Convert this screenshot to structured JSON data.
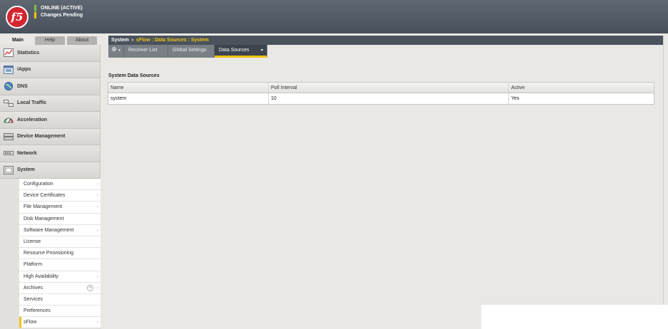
{
  "header": {
    "logo_text": "f5",
    "status_online": "ONLINE (ACTIVE)",
    "status_pending": "Changes Pending",
    "status_colors": {
      "online": "#7dc242",
      "pending": "#f1c40f"
    }
  },
  "top_tabs": [
    {
      "label": "Main",
      "active": true
    },
    {
      "label": "Help",
      "active": false
    },
    {
      "label": "About",
      "active": false
    }
  ],
  "sidebar": {
    "items": [
      {
        "label": "Statistics",
        "icon": "statistics-icon"
      },
      {
        "label": "iApps",
        "icon": "iapps-icon"
      },
      {
        "label": "DNS",
        "icon": "dns-globe-icon"
      },
      {
        "label": "Local Traffic",
        "icon": "local-traffic-icon"
      },
      {
        "label": "Acceleration",
        "icon": "acceleration-gauge-icon"
      },
      {
        "label": "Device Management",
        "icon": "device-management-icon"
      },
      {
        "label": "Network",
        "icon": "network-icon"
      },
      {
        "label": "System",
        "icon": "system-icon"
      }
    ],
    "system_subitems": [
      {
        "label": "Configuration",
        "arrow": "›"
      },
      {
        "label": "Device Certificates",
        "arrow": "›"
      },
      {
        "label": "File Management",
        "arrow": "›"
      },
      {
        "label": "Disk Management",
        "arrow": ""
      },
      {
        "label": "Software Management",
        "arrow": "›"
      },
      {
        "label": "License",
        "arrow": ""
      },
      {
        "label": "Resource Provisioning",
        "arrow": ""
      },
      {
        "label": "Platform",
        "arrow": ""
      },
      {
        "label": "High Availability",
        "arrow": "›"
      },
      {
        "label": "Archives",
        "arrow": "›",
        "plus": "+"
      },
      {
        "label": "Services",
        "arrow": ""
      },
      {
        "label": "Preferences",
        "arrow": ""
      },
      {
        "label": "sFlow",
        "arrow": "›",
        "selected": true
      }
    ]
  },
  "breadcrumb": {
    "root": "System",
    "separator": "»",
    "current": "sFlow : Data Sources : System"
  },
  "tool_tabs": {
    "gear_caret": "▾",
    "receiver_list": "Receiver List",
    "global_settings": "Global Settings",
    "data_sources": "Data Sources",
    "data_sources_caret": "▾"
  },
  "section": {
    "title": "System Data Sources",
    "columns": [
      "Name",
      "Poll Interval",
      "Active"
    ],
    "rows": [
      [
        "system",
        "10",
        "Yes"
      ]
    ]
  }
}
